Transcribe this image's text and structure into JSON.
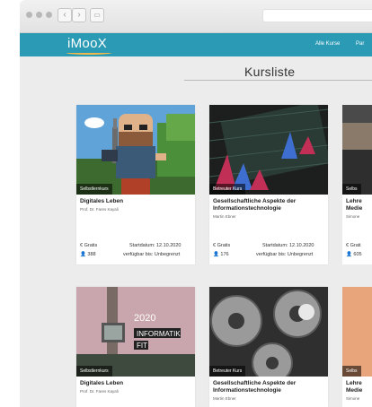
{
  "header": {
    "logo": "iMooX",
    "nav": [
      "Alle Kurse",
      "Par"
    ]
  },
  "page": {
    "title": "Kursliste"
  },
  "courses": [
    {
      "badge": "Selbstlernkurs",
      "title": "Digitales Leben",
      "author": "Prof. Dr. Fares Kayali",
      "price": "Gratis",
      "start": "Startdatum: 12.10.2020",
      "enrolled": "388",
      "available": "verfügbar bis: Unbegrenzt"
    },
    {
      "badge": "Betreuter Kurs",
      "title": "Gesellschaftliche Aspekte der Informationstechnologie",
      "author": "Martin Ebner",
      "price": "Gratis",
      "start": "Startdatum: 12.10.2020",
      "enrolled": "176",
      "available": "verfügbar bis: Unbegrenzt"
    },
    {
      "badge": "Selbs",
      "title": "Lehre Medie",
      "author": "Simone",
      "price": "Grati",
      "enrolled": "605"
    },
    {
      "badge": "Selbstlernkurs",
      "title": "Digitales Leben",
      "author": "Prof. Dr. Fares Kayali",
      "image_text": [
        "2020",
        "INFORMATIK",
        "FIT"
      ]
    },
    {
      "badge": "Betreuter Kurs",
      "title": "Gesellschaftliche Aspekte der Informationstechnologie",
      "author": "Martin Ebner"
    },
    {
      "badge": "Selbs",
      "title": "Lehre Medie",
      "author": "Simone"
    }
  ],
  "icons": {
    "price": "euro-icon",
    "users": "users-icon"
  },
  "colors": {
    "header": "#2a9ab5",
    "accent": "#f2b84b",
    "background": "#ececec"
  }
}
